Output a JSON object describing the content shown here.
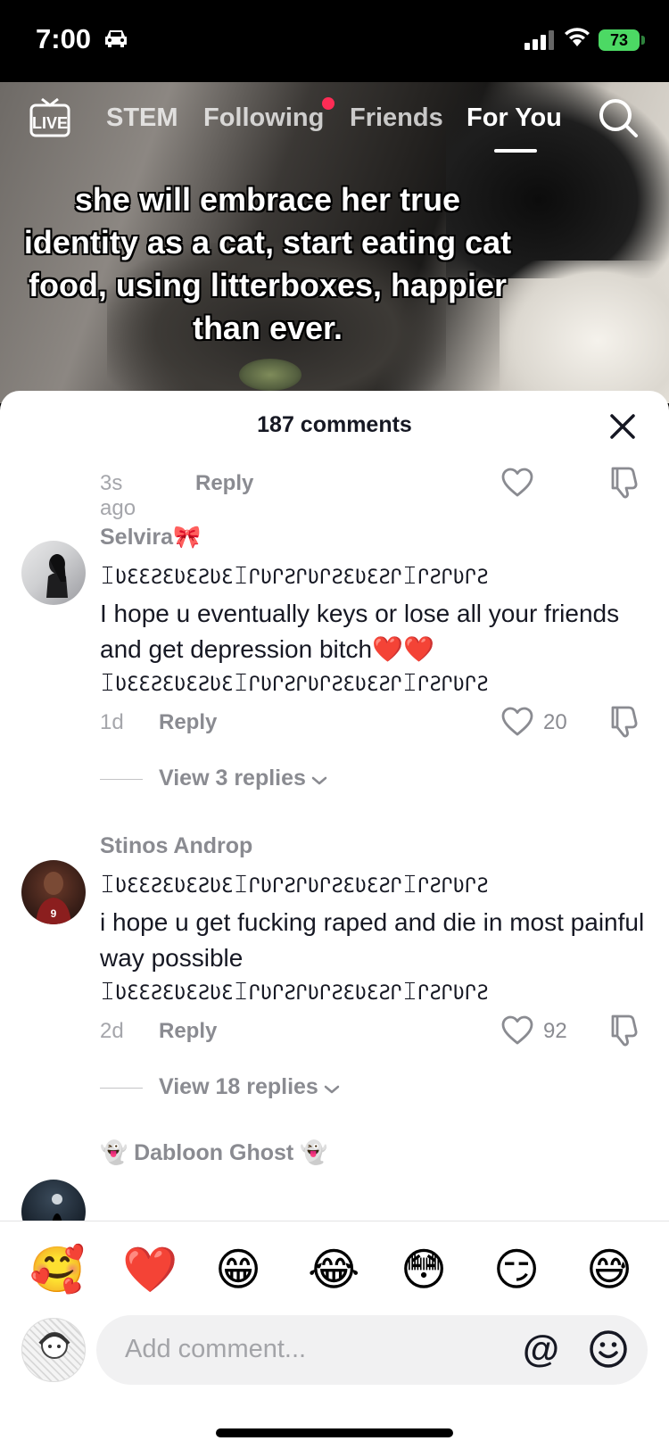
{
  "status_bar": {
    "time": "7:00",
    "battery": "73"
  },
  "top_nav": {
    "live_label": "LIVE",
    "tabs": [
      "STEM",
      "Following",
      "Friends",
      "For You"
    ],
    "active_tab": "For You"
  },
  "video": {
    "caption": "she will embrace her true identity as a cat, start eating cat food, using litterboxes, happier than ever."
  },
  "comments_sheet": {
    "title": "187 comments",
    "partial_row": {
      "time": "3s ago",
      "reply_label": "Reply"
    },
    "comments": [
      {
        "username": "Selvira🎀",
        "glyph_line": "ꀤƲƐƐƧƐƲƐƧƲƐꀤՐƲՐƧՐƲՐƧƐƲƐƧՐꀤՐƧՐƲՐƧ",
        "text": "I hope u eventually keys or lose all your friends and get depression bitch❤️❤️",
        "time": "1d",
        "reply_label": "Reply",
        "likes": "20",
        "view_replies": "View 3 replies"
      },
      {
        "username": "Stinos  Androp",
        "glyph_line": "ꀤƲƐƐƧƐƲƐƧƲƐꀤՐƲՐƧՐƲՐƧƐƲƐƧՐꀤՐƧՐƲՐƧ",
        "text": "i hope u get fucking raped and die in most painful way possible",
        "time": "2d",
        "reply_label": "Reply",
        "likes": "92",
        "view_replies": "View 18 replies"
      },
      {
        "username": "👻 Dabloon Ghost 👻"
      }
    ]
  },
  "quick_emojis": [
    "🥰",
    "❤️",
    "😁",
    "😂",
    "😳",
    "😏",
    "😅"
  ],
  "comment_input": {
    "placeholder": "Add comment..."
  }
}
